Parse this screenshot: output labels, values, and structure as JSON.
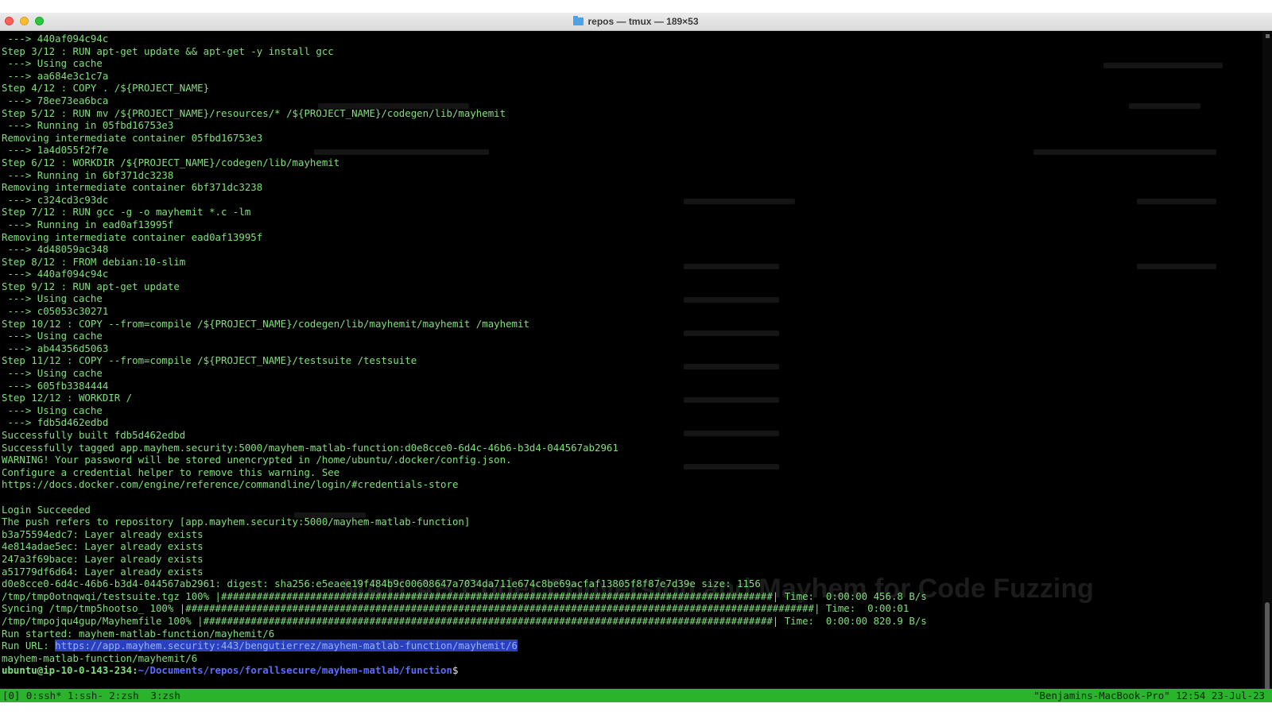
{
  "window": {
    "title": "repos — tmux — 189×53"
  },
  "terminal": {
    "lines": [
      " ---> 440af094c94c",
      "Step 3/12 : RUN apt-get update && apt-get -y install gcc",
      " ---> Using cache",
      " ---> aa684e3c1c7a",
      "Step 4/12 : COPY . /${PROJECT_NAME}",
      " ---> 78ee73ea6bca",
      "Step 5/12 : RUN mv /${PROJECT_NAME}/resources/* /${PROJECT_NAME}/codegen/lib/mayhemit",
      " ---> Running in 05fbd16753e3",
      "Removing intermediate container 05fbd16753e3",
      " ---> 1a4d055f2f7e",
      "Step 6/12 : WORKDIR /${PROJECT_NAME}/codegen/lib/mayhemit",
      " ---> Running in 6bf371dc3238",
      "Removing intermediate container 6bf371dc3238",
      " ---> c324cd3c93dc",
      "Step 7/12 : RUN gcc -g -o mayhemit *.c -lm",
      " ---> Running in ead0af13995f",
      "Removing intermediate container ead0af13995f",
      " ---> 4d48059ac348",
      "Step 8/12 : FROM debian:10-slim",
      " ---> 440af094c94c",
      "Step 9/12 : RUN apt-get update",
      " ---> Using cache",
      " ---> c05053c30271",
      "Step 10/12 : COPY --from=compile /${PROJECT_NAME}/codegen/lib/mayhemit/mayhemit /mayhemit",
      " ---> Using cache",
      " ---> ab44356d5063",
      "Step 11/12 : COPY --from=compile /${PROJECT_NAME}/testsuite /testsuite",
      " ---> Using cache",
      " ---> 605fb3384444",
      "Step 12/12 : WORKDIR /",
      " ---> Using cache",
      " ---> fdb5d462edbd",
      "Successfully built fdb5d462edbd",
      "Successfully tagged app.mayhem.security:5000/mayhem-matlab-function:d0e8cce0-6d4c-46b6-b3d4-044567ab2961",
      "WARNING! Your password will be stored unencrypted in /home/ubuntu/.docker/config.json.",
      "Configure a credential helper to remove this warning. See",
      "https://docs.docker.com/engine/reference/commandline/login/#credentials-store",
      "",
      "Login Succeeded",
      "The push refers to repository [app.mayhem.security:5000/mayhem-matlab-function]",
      "b3a75594edc7: Layer already exists",
      "4e814adae5ec: Layer already exists",
      "247a3f69bace: Layer already exists",
      "a51779df6d64: Layer already exists",
      "d0e8cce0-6d4c-46b6-b3d4-044567ab2961: digest: sha256:e5eaee19f484b9c00608647a7034da711e674c8be69acfaf13805f8f87e7d39e size: 1156",
      "/tmp/tmp0otnqwqi/testsuite.tgz 100% |#############################################################################################| Time:  0:00:00 456.8 B/s",
      "Syncing /tmp/tmp5hootso_ 100% |##########################################################################################################| Time:  0:00:01",
      "/tmp/tmpojqu4gup/Mayhemfile 100% |################################################################################################| Time:  0:00:00 820.9 B/s",
      "Run started: mayhem-matlab-function/mayhemit/6"
    ],
    "run_url_label": "Run URL: ",
    "run_url": "https://app.mayhem.security:443/bengutierrez/mayhem-matlab-function/mayhemit/6",
    "run_id_line": "mayhem-matlab-function/mayhemit/6",
    "prompt_user": "ubuntu@ip-10-0-143-234:",
    "prompt_path": "~/Documents/repos/forallsecure/mayhem-matlab/function",
    "prompt_symbol": "$"
  },
  "statusbar": {
    "left": "[0] 0:ssh* 1:ssh- 2:zsh  3:zsh",
    "right": "\"Benjamins-MacBook-Pro\" 12:54 23-Jul-23"
  },
  "background": {
    "ghost_title": "MATLAB Coder Conversion and Mayhem for Code Fuzzing"
  },
  "colors": {
    "terminal_text": "#7fe07a",
    "status_bar": "#2bb32b",
    "url_highlight": "#2c3fc0",
    "prompt_path": "#5c6cff"
  }
}
